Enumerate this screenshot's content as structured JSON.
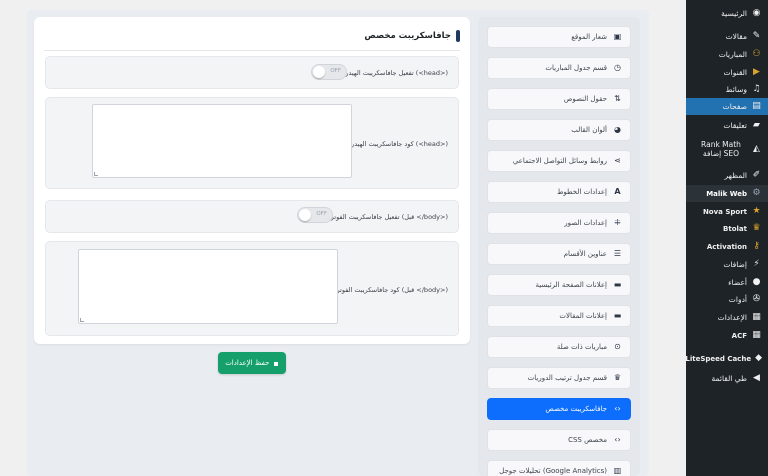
{
  "wp_menu": {
    "items": [
      {
        "label": "الرئيسية",
        "icon": "dashboard-icon"
      },
      {
        "label": "مقالات",
        "icon": "pin-icon"
      },
      {
        "label": "المباريات",
        "icon": "match-icon"
      },
      {
        "label": "القنوات",
        "icon": "play-icon"
      },
      {
        "label": "وسائط",
        "icon": "media-icon"
      },
      {
        "label": "صفحات",
        "icon": "page-icon"
      },
      {
        "label": "تعليقات",
        "icon": "comment-icon"
      },
      {
        "label": "Rank Math إضافة SEO",
        "icon": "chart-icon"
      },
      {
        "label": "المظهر",
        "icon": "brush-icon"
      },
      {
        "label": "Malik Web",
        "icon": "settings-icon"
      },
      {
        "label": "Nova Sport",
        "icon": "star-icon"
      },
      {
        "label": "Btolat",
        "icon": "trophy-icon"
      },
      {
        "label": "Activation",
        "icon": "key-icon"
      },
      {
        "label": "إضافات",
        "icon": "plugin-icon"
      },
      {
        "label": "أعضاء",
        "icon": "user-icon"
      },
      {
        "label": "أدوات",
        "icon": "wrench-icon"
      },
      {
        "label": "الإعدادات",
        "icon": "sliders-icon"
      },
      {
        "label": "ACF",
        "icon": "grid-icon"
      },
      {
        "label": "LiteSpeed Cache",
        "icon": "diamond-icon"
      },
      {
        "label": "طي القائمة",
        "icon": "collapse-icon"
      }
    ]
  },
  "tabs": [
    {
      "label": "شعار الموقع",
      "icon": "image-icon"
    },
    {
      "label": "قسم جدول المباريات",
      "icon": "clock-icon"
    },
    {
      "label": "حقول النصوص",
      "icon": "text-fields-icon"
    },
    {
      "label": "ألوان القالب",
      "icon": "palette-icon"
    },
    {
      "label": "روابط وسائل التواصل الاجتماعي",
      "icon": "share-icon"
    },
    {
      "label": "إعدادات الخطوط",
      "icon": "font-icon"
    },
    {
      "label": "إعدادات الصور",
      "icon": "image-settings-icon"
    },
    {
      "label": "عناوين الأقسام",
      "icon": "list-icon"
    },
    {
      "label": "إعلانات الصفحة الرئيسية",
      "icon": "ad-icon"
    },
    {
      "label": "إعلانات المقالات",
      "icon": "ad-icon"
    },
    {
      "label": "مباريات ذات صلة",
      "icon": "ball-icon"
    },
    {
      "label": "قسم جدول ترتيب الدوريات",
      "icon": "trophy-icon"
    },
    {
      "label": "جافاسكريبت مخصص",
      "icon": "code-icon"
    },
    {
      "label": "CSS مخصص",
      "icon": "code-icon"
    },
    {
      "label": "تحليلات جوجل (Google Analytics)",
      "icon": "analytics-icon"
    }
  ],
  "card": {
    "title": "جافاسكريبت مخصص",
    "header_toggle_label": "تفعيل جافاسكريبت الهيدر (<head>)",
    "header_toggle_state": "OFF",
    "header_code_label": "كود جافاسكريبت الهيدر (<head>)",
    "footer_toggle_label": "تفعيل جافاسكريبت الفوتر (قبل </body>)",
    "footer_toggle_state": "OFF",
    "footer_code_label": "كود جافاسكريبت الفوتر (قبل </body>)"
  },
  "save_button": {
    "label": "حفظ الإعدادات",
    "icon": "save-icon"
  },
  "colors": {
    "accent": "#0d6efd",
    "save": "#15a06b",
    "wp_sidebar": "#1d2327",
    "wp_active": "#2271b1"
  }
}
